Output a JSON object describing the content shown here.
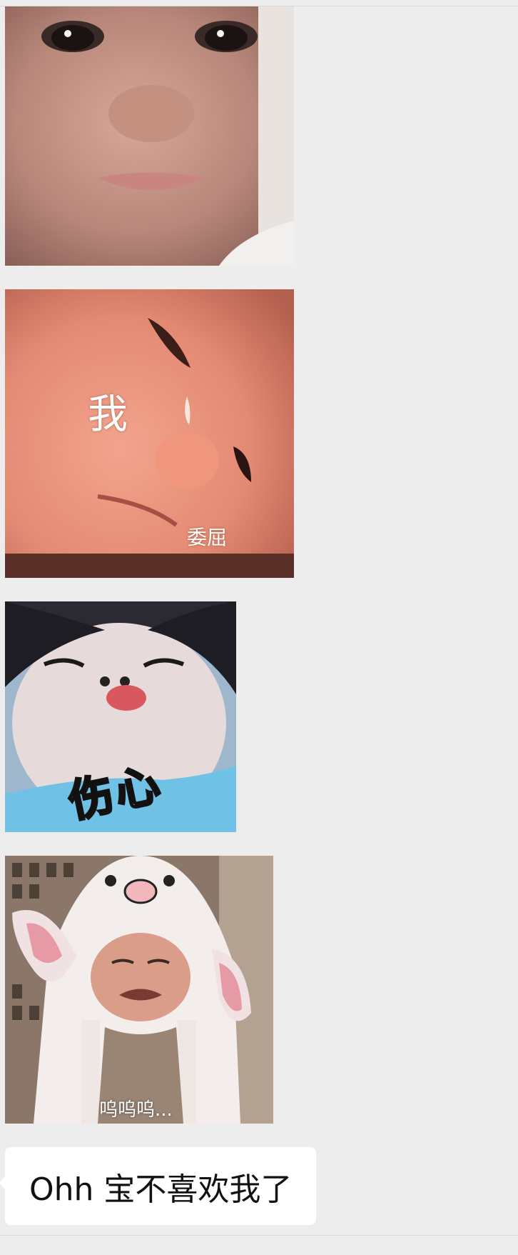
{
  "chat": {
    "messages": [
      {
        "type": "sticker",
        "description_icon": "crying-baby-face-sticker",
        "caption": ""
      },
      {
        "type": "sticker",
        "description_icon": "teary-baby-face-sticker",
        "caption_large": "我",
        "caption_small": "委屈"
      },
      {
        "type": "sticker",
        "description_icon": "pouting-baby-sticker",
        "caption": "伤心"
      },
      {
        "type": "sticker",
        "description_icon": "baby-bunny-hat-crying-sticker",
        "caption": "呜呜呜..."
      },
      {
        "type": "text",
        "text": "Ohh 宝不喜欢我了"
      }
    ]
  },
  "colors": {
    "background": "#ededed",
    "bubble": "#ffffff",
    "text": "#111111"
  }
}
